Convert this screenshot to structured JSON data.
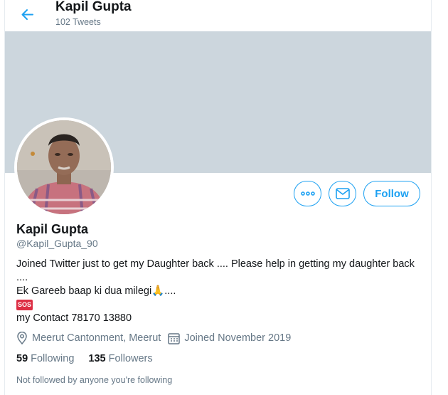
{
  "header": {
    "name": "Kapil Gupta",
    "tweet_count": "102 Tweets"
  },
  "profile": {
    "display_name": "Kapil Gupta",
    "handle": "@Kapil_Gupta_90",
    "follow_label": "Follow",
    "bio_line1": "Joined Twitter just to get my Daughter back .... Please help in getting my daughter back ....",
    "bio_line2": "Ek Gareeb baap ki dua milegi🙏....",
    "bio_sos": "SOS",
    "bio_line3": "my Contact 78170 13880",
    "location": "Meerut Cantonment, Meerut",
    "joined": "Joined November 2019",
    "following_count": "59",
    "following_label": "Following",
    "followers_count": "135",
    "followers_label": "Followers",
    "followed_by_note": "Not followed by anyone you're following"
  },
  "icons": {
    "back": "arrow-left-icon",
    "more": "more-dots-icon",
    "message": "envelope-icon",
    "location": "location-pin-icon",
    "calendar": "calendar-icon"
  },
  "colors": {
    "accent": "#1da1f2",
    "banner": "#ccd6dd",
    "secondary_text": "#657786"
  }
}
